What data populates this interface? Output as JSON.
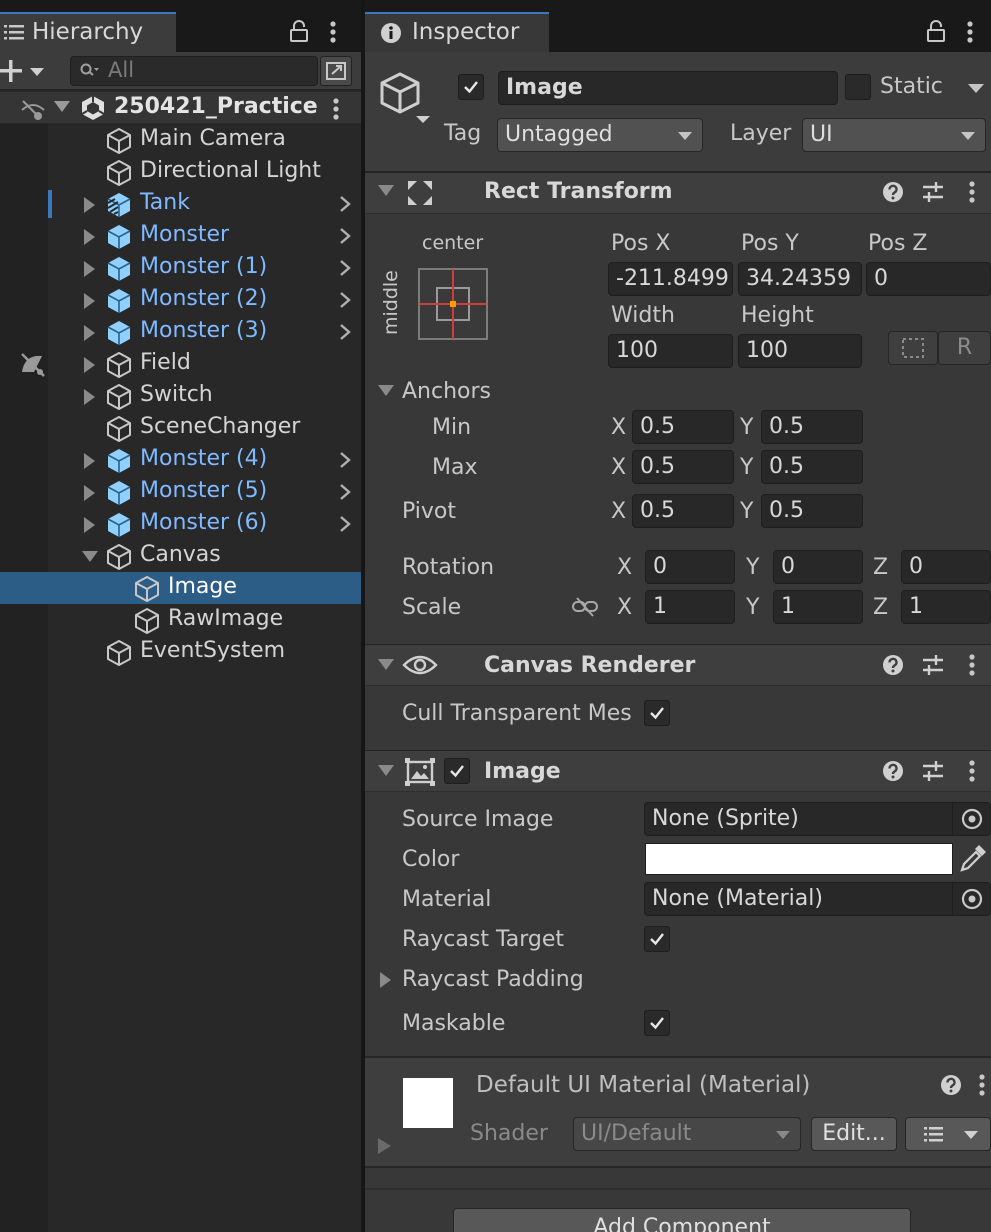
{
  "hierarchy": {
    "tab_label": "Hierarchy",
    "search_placeholder": "All",
    "scene_name": "250421_Practice",
    "items": [
      {
        "label": "Main Camera",
        "depth": 0,
        "fold": "none",
        "prefab": false,
        "selected": false
      },
      {
        "label": "Directional Light",
        "depth": 0,
        "fold": "none",
        "prefab": false,
        "selected": false
      },
      {
        "label": "Tank",
        "depth": 0,
        "fold": "closed",
        "prefab": true,
        "selected": false,
        "chevron": true,
        "variant": true
      },
      {
        "label": "Monster",
        "depth": 0,
        "fold": "closed",
        "prefab": true,
        "selected": false,
        "chevron": true
      },
      {
        "label": "Monster (1)",
        "depth": 0,
        "fold": "closed",
        "prefab": true,
        "selected": false,
        "chevron": true
      },
      {
        "label": "Monster (2)",
        "depth": 0,
        "fold": "closed",
        "prefab": true,
        "selected": false,
        "chevron": true
      },
      {
        "label": "Monster (3)",
        "depth": 0,
        "fold": "closed",
        "prefab": true,
        "selected": false,
        "chevron": true
      },
      {
        "label": "Field",
        "depth": 0,
        "fold": "closed",
        "prefab": false,
        "selected": false,
        "hidden_marker": true
      },
      {
        "label": "Switch",
        "depth": 0,
        "fold": "closed",
        "prefab": false,
        "selected": false
      },
      {
        "label": "SceneChanger",
        "depth": 0,
        "fold": "none",
        "prefab": false,
        "selected": false
      },
      {
        "label": "Monster (4)",
        "depth": 0,
        "fold": "closed",
        "prefab": true,
        "selected": false,
        "chevron": true
      },
      {
        "label": "Monster (5)",
        "depth": 0,
        "fold": "closed",
        "prefab": true,
        "selected": false,
        "chevron": true
      },
      {
        "label": "Monster (6)",
        "depth": 0,
        "fold": "closed",
        "prefab": true,
        "selected": false,
        "chevron": true
      },
      {
        "label": "Canvas",
        "depth": 0,
        "fold": "open",
        "prefab": false,
        "selected": false
      },
      {
        "label": "Image",
        "depth": 1,
        "fold": "none",
        "prefab": false,
        "selected": true
      },
      {
        "label": "RawImage",
        "depth": 1,
        "fold": "none",
        "prefab": false,
        "selected": false
      },
      {
        "label": "EventSystem",
        "depth": 0,
        "fold": "none",
        "prefab": false,
        "selected": false
      }
    ]
  },
  "inspector": {
    "tab_label": "Inspector",
    "object_name": "Image",
    "active": true,
    "static_label": "Static",
    "tag_label": "Tag",
    "tag_value": "Untagged",
    "layer_label": "Layer",
    "layer_value": "UI",
    "rect_transform": {
      "title": "Rect Transform",
      "anchor_h": "center",
      "anchor_v": "middle",
      "pos_x_label": "Pos X",
      "pos_y_label": "Pos Y",
      "pos_z_label": "Pos Z",
      "pos_x": "-211.8499",
      "pos_y": "34.24359",
      "pos_z": "0",
      "width_label": "Width",
      "height_label": "Height",
      "width": "100",
      "height": "100",
      "r_button": "R",
      "anchors_label": "Anchors",
      "min_label": "Min",
      "max_label": "Max",
      "pivot_label": "Pivot",
      "x_label": "X",
      "y_label": "Y",
      "z_label": "Z",
      "min_x": "0.5",
      "min_y": "0.5",
      "max_x": "0.5",
      "max_y": "0.5",
      "pivot_x": "0.5",
      "pivot_y": "0.5",
      "rotation_label": "Rotation",
      "rot_x": "0",
      "rot_y": "0",
      "rot_z": "0",
      "scale_label": "Scale",
      "scale_x": "1",
      "scale_y": "1",
      "scale_z": "1"
    },
    "canvas_renderer": {
      "title": "Canvas Renderer",
      "cull_label": "Cull Transparent Mes",
      "cull_checked": true
    },
    "image": {
      "title": "Image",
      "enabled": true,
      "source_image_label": "Source Image",
      "source_image_value": "None (Sprite)",
      "color_label": "Color",
      "color_value": "#ffffff",
      "material_label": "Material",
      "material_value": "None (Material)",
      "raycast_target_label": "Raycast Target",
      "raycast_target": true,
      "raycast_padding_label": "Raycast Padding",
      "maskable_label": "Maskable",
      "maskable": true
    },
    "material_block": {
      "title": "Default UI Material (Material)",
      "shader_label": "Shader",
      "shader_value": "UI/Default",
      "edit_button": "Edit..."
    },
    "add_component": "Add Component"
  },
  "colors": {
    "accent": "#3a79bb",
    "selection": "#2c5d87",
    "prefab_text": "#7fb9ff",
    "anchor_red": "#d23c3c",
    "anchor_orange": "#f0a000"
  }
}
